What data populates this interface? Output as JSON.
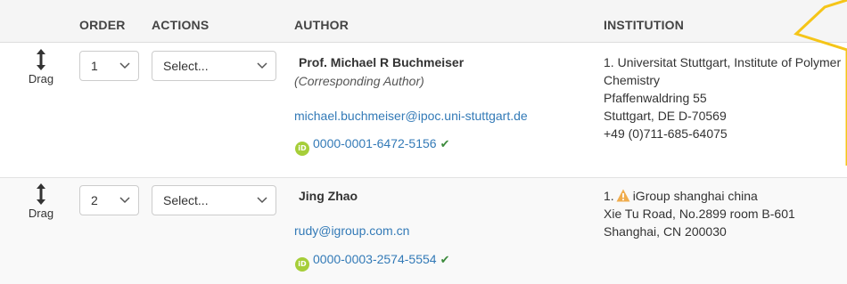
{
  "table": {
    "headers": {
      "order": "ORDER",
      "actions": "ACTIONS",
      "author": "AUTHOR",
      "institution": "INSTITUTION"
    },
    "rows": [
      {
        "drag_label": "Drag",
        "order": "1",
        "action": "Select...",
        "name": "Prof. Michael R Buchmeiser",
        "role": "(Corresponding Author)",
        "email": "michael.buchmeiser@ipoc.uni-stuttgart.de",
        "orcid": "0000-0001-6472-5156",
        "institution": {
          "prefix": "1.",
          "lines": [
            "Universitat Stuttgart, Institute of Polymer",
            "Chemistry",
            "Pfaffenwaldring 55",
            "Stuttgart, DE D-70569",
            "+49 (0)711-685-64075"
          ]
        }
      },
      {
        "drag_label": "Drag",
        "order": "2",
        "action": "Select...",
        "name": "Jing Zhao",
        "email": "rudy@igroup.com.cn",
        "orcid": "0000-0003-2574-5554",
        "institution": {
          "prefix": "1.",
          "name": "iGroup shanghai china",
          "lines": [
            "Xie Tu Road, No.2899 room B-601",
            "Shanghai, CN 200030"
          ]
        }
      }
    ]
  },
  "icons": {
    "drag": "vertical-resize-arrow-icon",
    "chevron": "chevron-down-icon",
    "orcid": "orcid-icon",
    "check": "check-icon",
    "warning": "warning-icon"
  },
  "colors": {
    "link": "#337ab7",
    "orcid": "#a6ce39",
    "warning": "#f0ad4e",
    "callout": "#f5c518",
    "header_bg": "#f5f5f5"
  }
}
